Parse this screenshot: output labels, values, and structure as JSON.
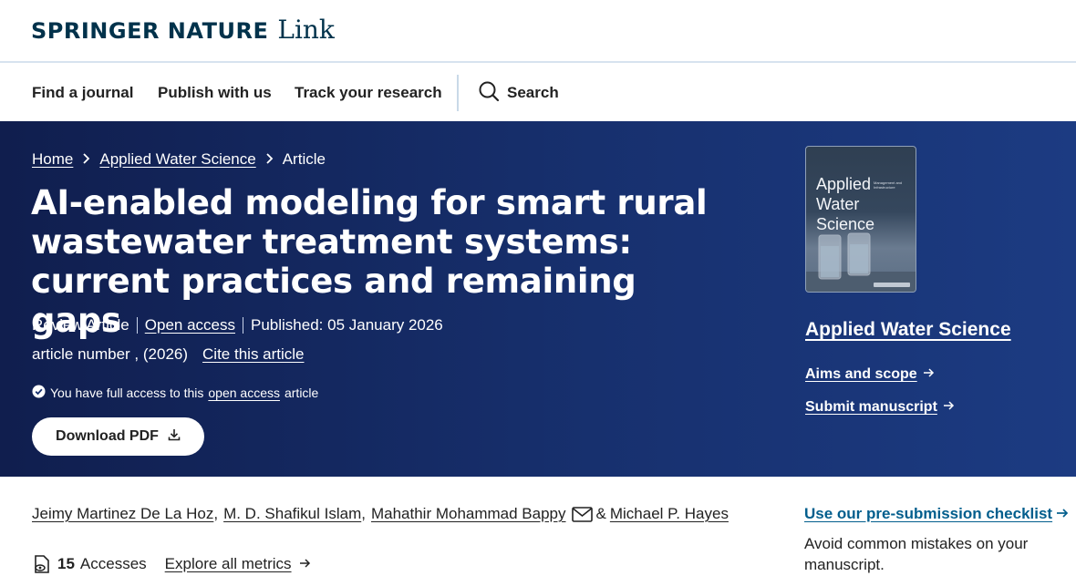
{
  "header": {
    "logo_main": "SPRINGER NATURE",
    "logo_sub": "Link"
  },
  "nav": {
    "items": [
      "Find a journal",
      "Publish with us",
      "Track your research"
    ],
    "search_label": "Search"
  },
  "breadcrumb": {
    "home": "Home",
    "journal": "Applied Water Science",
    "current": "Article",
    "separator": ">"
  },
  "article": {
    "title": "AI-enabled modeling for smart rural wastewater treatment systems: current practices and remaining gaps",
    "type": "Review Article",
    "open_access": "Open access",
    "published": "Published: 05 January 2026",
    "article_number": "article number , (2026)",
    "cite": "Cite this article",
    "access_prefix": "You have full access to this",
    "access_link": "open access",
    "access_suffix": "article",
    "download_label": "Download PDF"
  },
  "journal": {
    "cover_title_line1": "Applied",
    "cover_title_line2": "Water Science",
    "cover_subtitle": "Management and Infrastructure",
    "name": "Applied Water Science",
    "aims_label": "Aims and scope",
    "submit_label": "Submit manuscript"
  },
  "authors": {
    "list": [
      "Jeimy Martinez De La Hoz",
      "M. D. Shafikul Islam",
      "Mahathir Mohammad Bappy",
      "Michael P. Hayes"
    ],
    "comma": ",",
    "ampersand": "&"
  },
  "metrics": {
    "accesses_count": "15",
    "accesses_label": "Accesses",
    "explore_label": "Explore all metrics"
  },
  "sidebar": {
    "checklist_label": "Use our pre-submission checklist",
    "checklist_desc": "Avoid common mistakes on your manuscript."
  },
  "colors": {
    "brand_navy": "#01324b",
    "hero_start": "#101e4e",
    "hero_end": "#1c3b82",
    "link_blue": "#025e8d"
  }
}
